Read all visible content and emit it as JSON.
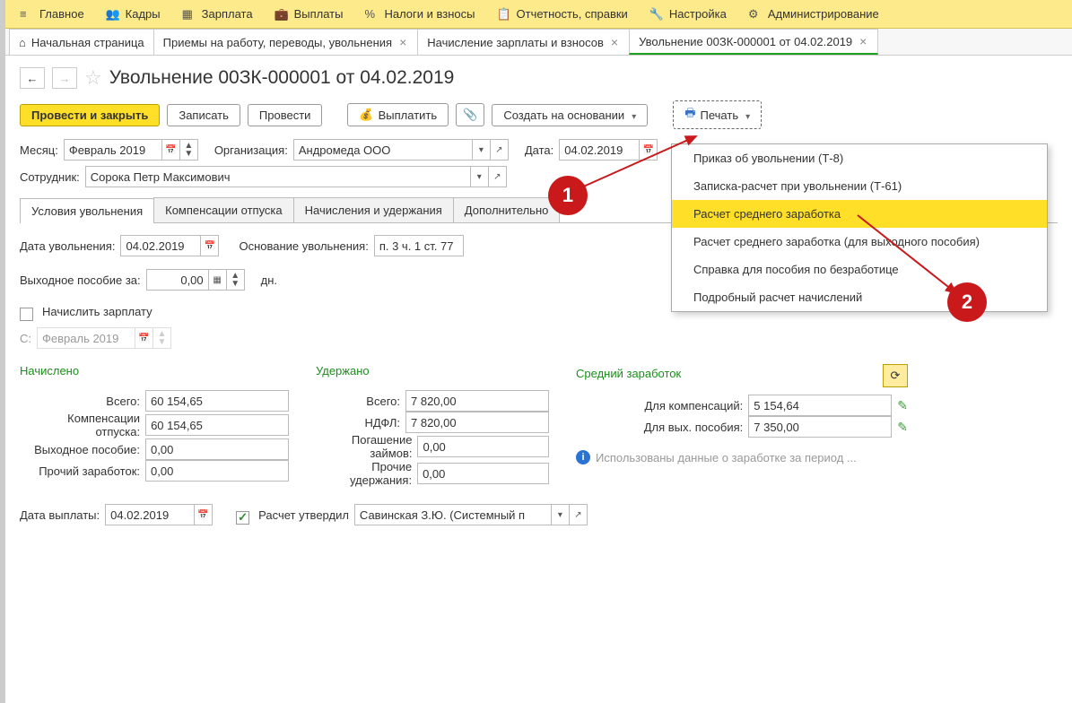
{
  "topmenu": [
    {
      "label": "Главное",
      "icon": "menu"
    },
    {
      "label": "Кадры",
      "icon": "users"
    },
    {
      "label": "Зарплата",
      "icon": "table"
    },
    {
      "label": "Выплаты",
      "icon": "wallet"
    },
    {
      "label": "Налоги и взносы",
      "icon": "percent"
    },
    {
      "label": "Отчетность, справки",
      "icon": "report"
    },
    {
      "label": "Настройка",
      "icon": "wrench"
    },
    {
      "label": "Администрирование",
      "icon": "gear"
    }
  ],
  "tabs": [
    {
      "label": "Начальная страница",
      "icon": "home",
      "closable": false
    },
    {
      "label": "Приемы на работу, переводы, увольнения",
      "closable": true
    },
    {
      "label": "Начисление зарплаты и взносов",
      "closable": true
    },
    {
      "label": "Увольнение 00ЗК-000001 от 04.02.2019",
      "closable": true,
      "active": true
    }
  ],
  "title": "Увольнение 00ЗК-000001 от 04.02.2019",
  "toolbar": {
    "post_close": "Провести и закрыть",
    "save": "Записать",
    "post": "Провести",
    "pay": "Выплатить",
    "create_based": "Создать на основании",
    "print": "Печать"
  },
  "form": {
    "month_label": "Месяц:",
    "month": "Февраль 2019",
    "org_label": "Организация:",
    "org": "Андромеда ООО",
    "date_label": "Дата:",
    "date": "04.02.2019",
    "emp_label": "Сотрудник:",
    "emp": "Сорока Петр Максимович"
  },
  "subtabs": [
    "Условия увольнения",
    "Компенсации отпуска",
    "Начисления и удержания",
    "Дополнительно"
  ],
  "cond": {
    "fire_date_label": "Дата увольнения:",
    "fire_date": "04.02.2019",
    "basis_label": "Основание увольнения:",
    "basis": "п. 3 ч. 1 ст. 77",
    "sev_label": "Выходное пособие за:",
    "sev_days": "0,00",
    "sev_unit": "дн.",
    "acc_salary": "Начислить зарплату",
    "from_label": "С:",
    "from": "Февраль 2019"
  },
  "sections": {
    "accrued": {
      "head": "Начислено",
      "rows": [
        {
          "label": "Всего:",
          "val": "60 154,65"
        },
        {
          "label": "Компенсации отпуска:",
          "val": "60 154,65"
        },
        {
          "label": "Выходное пособие:",
          "val": "0,00"
        },
        {
          "label": "Прочий заработок:",
          "val": "0,00"
        }
      ]
    },
    "withheld": {
      "head": "Удержано",
      "rows": [
        {
          "label": "Всего:",
          "val": "7 820,00"
        },
        {
          "label": "НДФЛ:",
          "val": "7 820,00"
        },
        {
          "label": "Погашение займов:",
          "val": "0,00"
        },
        {
          "label": "Прочие удержания:",
          "val": "0,00"
        }
      ]
    },
    "avg": {
      "head": "Средний заработок",
      "rows": [
        {
          "label": "Для компенсаций:",
          "val": "5 154,64"
        },
        {
          "label": "Для вых. пособия:",
          "val": "7 350,00"
        }
      ],
      "info": "Использованы данные о заработке за период ..."
    }
  },
  "footer": {
    "pay_date_label": "Дата выплаты:",
    "pay_date": "04.02.2019",
    "approved": "Расчет утвердил",
    "approver": "Савинская З.Ю. (Системный п"
  },
  "printmenu": [
    "Приказ об увольнении (Т-8)",
    "Записка-расчет при увольнении (Т-61)",
    "Расчет среднего заработка",
    "Расчет среднего заработка (для выходного пособия)",
    "Справка для пособия по безработице",
    "Подробный расчет начислений"
  ],
  "printmenu_highlight": 2
}
